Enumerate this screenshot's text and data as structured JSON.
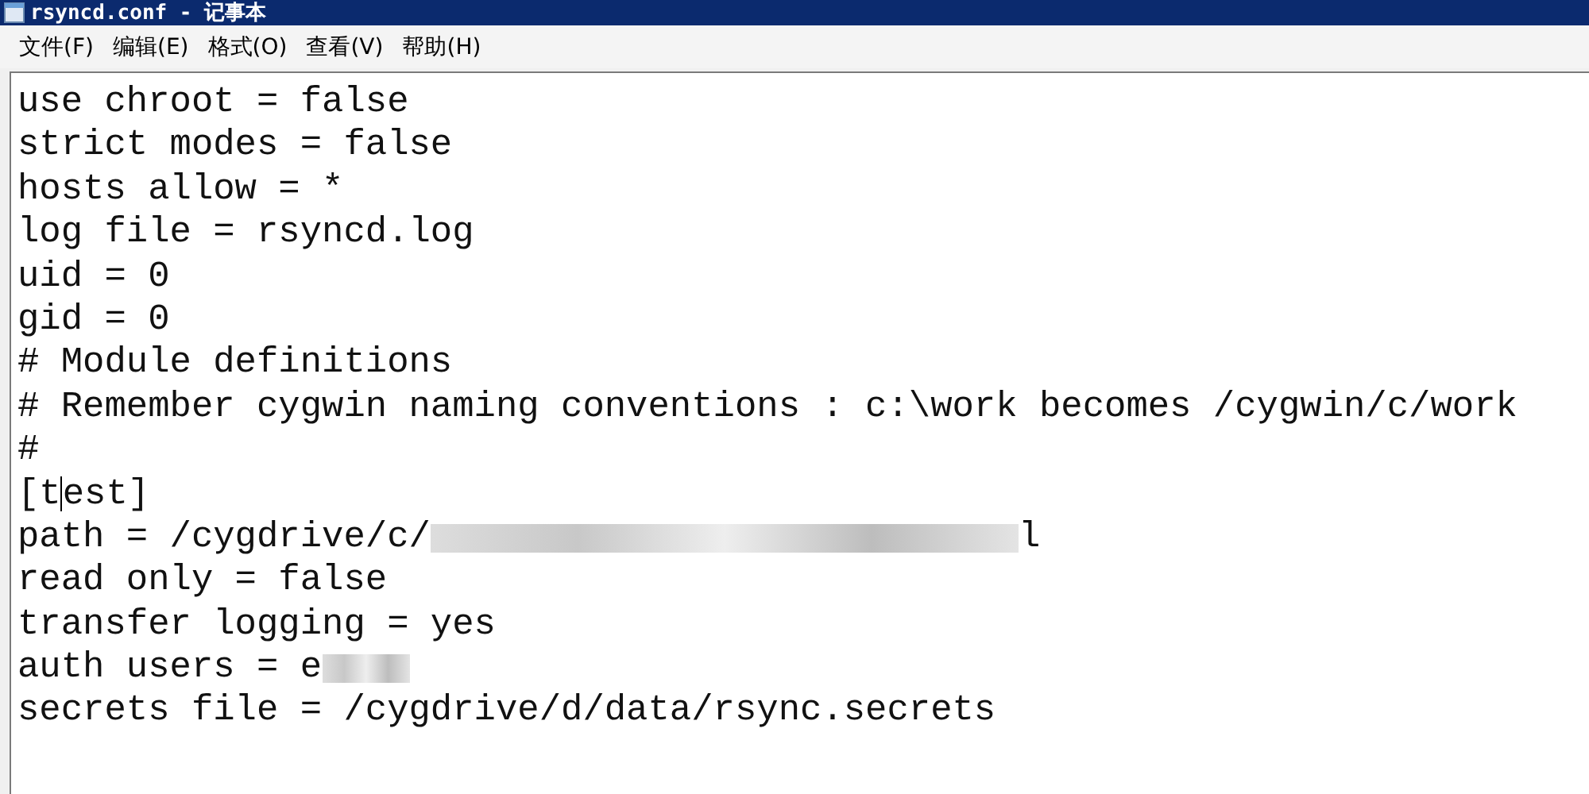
{
  "window": {
    "title": "rsyncd.conf - 记事本"
  },
  "menu": [
    "文件(F)",
    "编辑(E)",
    "格式(O)",
    "查看(V)",
    "帮助(H)"
  ],
  "lines": [
    {
      "kind": "text",
      "text": "use chroot = false"
    },
    {
      "kind": "text",
      "text": "strict modes = false"
    },
    {
      "kind": "text",
      "text": "hosts allow = *"
    },
    {
      "kind": "text",
      "text": "log file = rsyncd.log"
    },
    {
      "kind": "text",
      "text": "uid = 0"
    },
    {
      "kind": "text",
      "text": "gid = 0"
    },
    {
      "kind": "text",
      "text": "# Module definitions"
    },
    {
      "kind": "text",
      "text": "# Remember cygwin naming conventions : c:\\work becomes /cygwin/c/work"
    },
    {
      "kind": "text",
      "text": "#"
    },
    {
      "kind": "caret",
      "before": "[t",
      "after": "est]"
    },
    {
      "kind": "redacted",
      "before": "path = /cygdrive/c/",
      "after": "l"
    },
    {
      "kind": "text",
      "text": "read only = false"
    },
    {
      "kind": "text",
      "text": "transfer logging = yes"
    },
    {
      "kind": "redacted",
      "before": "auth users = e"
    },
    {
      "kind": "text",
      "text": "secrets file = /cygdrive/d/data/rsync.secrets"
    }
  ]
}
